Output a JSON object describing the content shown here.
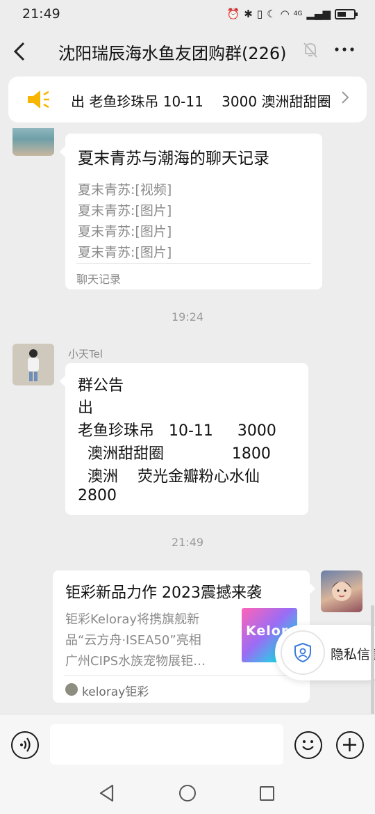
{
  "status_bar": {
    "time": "21:49",
    "network": "4G"
  },
  "header": {
    "title": "沈阳瑞辰海水鱼友团购群(226)"
  },
  "notice_bar": {
    "text": "出 老鱼珍珠吊 10-11　 3000 澳洲甜甜圈"
  },
  "messages": {
    "chat_record": {
      "title": "夏末青苏与潮海的聊天记录",
      "lines": [
        "夏末青苏:[视频]",
        "夏末青苏:[图片]",
        "夏末青苏:[图片]",
        "夏末青苏:[图片]"
      ],
      "footer": "聊天记录"
    },
    "time_1": "19:24",
    "announcement": {
      "sender": "小天Tel",
      "lines": [
        "群公告",
        "出",
        "老鱼珍珠吊   10-11     3000",
        "  澳洲甜甜圈              1800",
        "  澳洲    荧光金瓣粉心水仙",
        "2800"
      ]
    },
    "time_2": "21:49",
    "link_card": {
      "title": "钜彩新品力作 2023震撼来袭",
      "desc_lines": [
        "钜彩Keloray将携旗舰新",
        "品“云方舟·ISEA50”亮相",
        "广州CIPS水族宠物展钜…"
      ],
      "thumb_text": "Keloray",
      "source": "keloray钜彩"
    }
  },
  "privacy_popup": {
    "text": "隐私信息"
  },
  "input_bar": {
    "placeholder": ""
  },
  "colors": {
    "background": "#ededed",
    "bubble": "#ffffff",
    "speaker": "#f7b500"
  }
}
